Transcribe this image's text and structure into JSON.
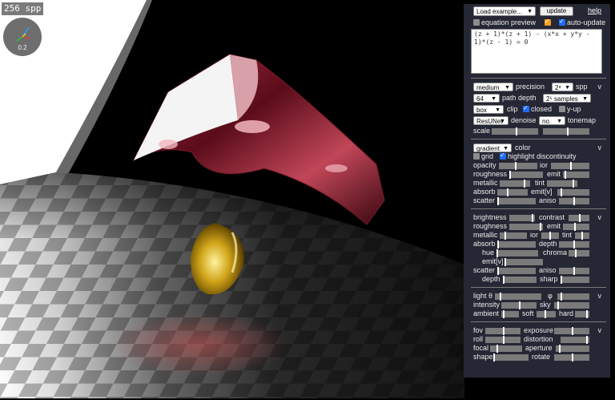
{
  "render": {
    "spp_counter": "256 spp",
    "gizmo_value": "0.2"
  },
  "top": {
    "load_example": "Load example...",
    "update": "update",
    "help": "help",
    "equation_preview": "equation preview",
    "equation_preview_checked": true,
    "auto_update": "auto-update",
    "auto_update_checked": true,
    "equation": "(z + 1)*(z + 1) - (x*x + y*y - 1)*(z - 1) = 0"
  },
  "render_settings": {
    "precision_select": "medium",
    "precision_label": "precision",
    "spp_select": "2⁸",
    "spp_label": "spp",
    "path_depth_select": "64",
    "path_depth_label": "path depth",
    "samples_select": "2⁵ samples",
    "clip_select": "box",
    "clip_label": "clip",
    "closed_label": "closed",
    "closed_checked": true,
    "yup_label": "y-up",
    "denoise_select": "ResUNet",
    "denoise_label": "denoise",
    "tonemap_select": "no",
    "tonemap_label": "tonemap",
    "scale_label": "scale",
    "toggle": "v"
  },
  "color_settings": {
    "color_select": "gradient",
    "color_label": "color",
    "toggle": "v",
    "grid_label": "grid",
    "highlight_label": "highlight discontinuity",
    "highlight_checked": true,
    "rows": [
      [
        "opacity",
        "ior"
      ],
      [
        "roughness",
        "emit"
      ],
      [
        "metallic",
        "tint"
      ],
      [
        "absorb",
        "emit[v]"
      ],
      [
        "scatter",
        "aniso"
      ]
    ]
  },
  "material_settings": {
    "toggle": "v",
    "rows": [
      [
        "brightness",
        "contrast"
      ],
      [
        "roughness",
        "emit"
      ],
      [
        "metallic",
        "ior",
        "tint"
      ],
      [
        "absorb",
        "depth"
      ],
      [
        "hue",
        "chroma"
      ],
      [
        "emit[v]"
      ],
      [
        "scatter",
        "aniso"
      ],
      [
        "depth",
        "sharp"
      ]
    ]
  },
  "light_settings": {
    "toggle": "v",
    "rows": [
      [
        "light θ",
        "φ"
      ],
      [
        "intensity",
        "sky"
      ],
      [
        "ambient",
        "soft",
        "hard"
      ]
    ]
  },
  "camera_settings": {
    "toggle": "v",
    "rows": [
      [
        "fov",
        "exposure"
      ],
      [
        "roll",
        "distortion"
      ],
      [
        "focal",
        "aperture"
      ],
      [
        "shape",
        "rotate"
      ]
    ]
  },
  "colors": {
    "panel_bg": "#252734",
    "checkbox_blue": "#1e6cff",
    "checkbox_orange": "#f0a020"
  }
}
